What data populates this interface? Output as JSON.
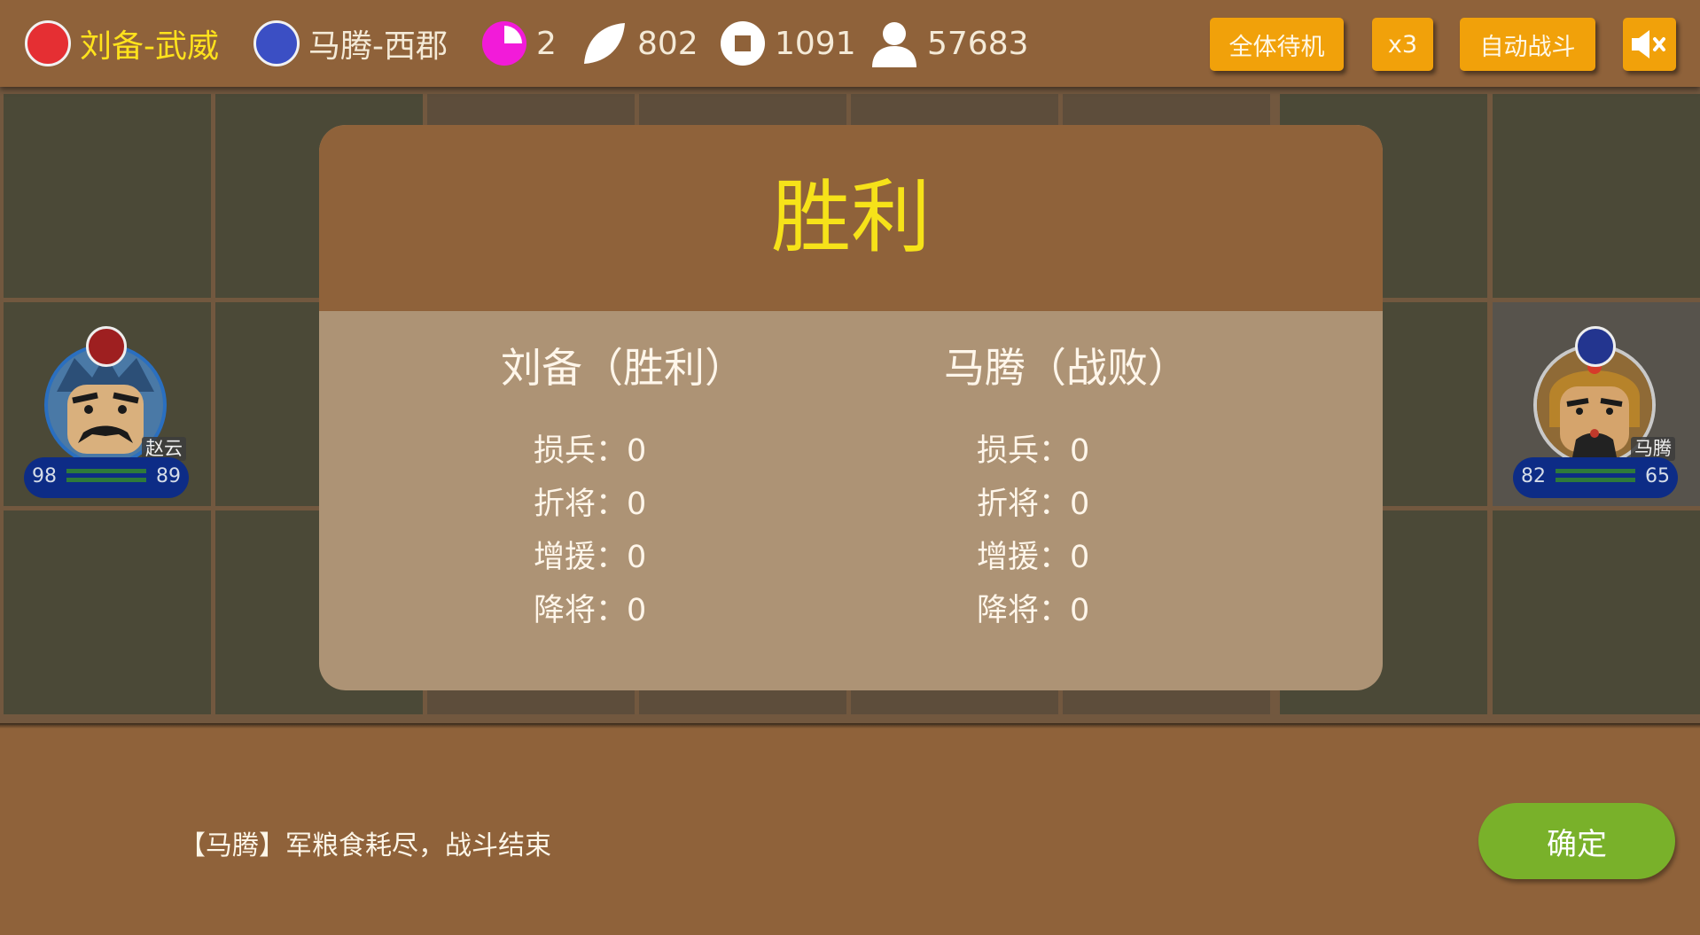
{
  "topbar": {
    "player": {
      "label": "刘备-武威",
      "color": "#e52f33"
    },
    "enemy": {
      "label": "马腾-西郡",
      "color": "#3b4fc4"
    },
    "stats": {
      "turn": "2",
      "food": "802",
      "gold": "1091",
      "troops": "57683"
    },
    "buttons": {
      "standby": "全体待机",
      "speed": "x3",
      "auto": "自动战斗"
    },
    "sound_icon": "speaker-muted-icon"
  },
  "units": {
    "player": {
      "name": "赵云",
      "left_value": "98",
      "right_value": "89",
      "flag_color": "#9e1f20"
    },
    "enemy": {
      "name": "马腾",
      "left_value": "82",
      "right_value": "65",
      "flag_color": "#23358f"
    }
  },
  "result": {
    "title": "胜利",
    "left": {
      "name": "刘备（胜利）",
      "stats": [
        {
          "label": "损兵：",
          "value": "0"
        },
        {
          "label": "折将：",
          "value": "0"
        },
        {
          "label": "增援：",
          "value": "0"
        },
        {
          "label": "降将：",
          "value": "0"
        }
      ]
    },
    "right": {
      "name": "马腾（战败）",
      "stats": [
        {
          "label": "损兵：",
          "value": "0"
        },
        {
          "label": "折将：",
          "value": "0"
        },
        {
          "label": "增援：",
          "value": "0"
        },
        {
          "label": "降将：",
          "value": "0"
        }
      ]
    }
  },
  "message": "【马腾】军粮食耗尽，战斗结束",
  "confirm_label": "确定",
  "colors": {
    "panel": "#8f623a",
    "dialog_body": "#ad9375",
    "title": "#f6e219",
    "button_orange": "#f1a10a",
    "button_green": "#79b12a"
  }
}
